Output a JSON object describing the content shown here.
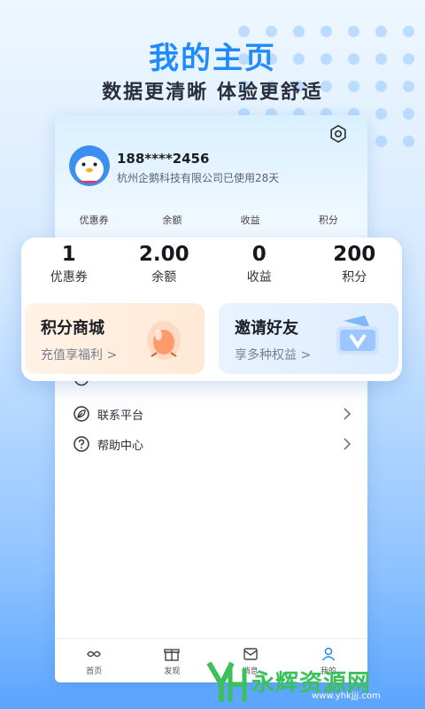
{
  "hero": {
    "title": "我的主页",
    "subtitle": "数据更清晰 体验更舒适"
  },
  "profile": {
    "phone": "188****2456",
    "company_line": "杭州企鹅科技有限公司已使用28天",
    "avatar_icon": "penguin-avatar"
  },
  "mini_stats": [
    "优惠券",
    "余额",
    "收益",
    "积分"
  ],
  "stats": [
    {
      "value": "1",
      "label": "优惠券"
    },
    {
      "value": "2.00",
      "label": "余额"
    },
    {
      "value": "0",
      "label": "收益"
    },
    {
      "value": "200",
      "label": "积分"
    }
  ],
  "promos": {
    "left": {
      "title": "积分商城",
      "subtitle": "充值享福利 >"
    },
    "right": {
      "title": "邀请好友",
      "subtitle": "享多种权益 >"
    }
  },
  "menu": {
    "contact": "联系平台",
    "help": "帮助中心"
  },
  "tabbar": [
    {
      "label": "首页",
      "icon": "home-icon"
    },
    {
      "label": "发现",
      "icon": "gift-icon"
    },
    {
      "label": "消息",
      "icon": "message-icon"
    },
    {
      "label": "我的",
      "icon": "profile-icon"
    }
  ],
  "watermark": {
    "text": "永辉资源网",
    "url": "www.yhkjjj.com"
  },
  "colors": {
    "accent": "#1f8bff",
    "watermark_green": "#3bc15a"
  }
}
